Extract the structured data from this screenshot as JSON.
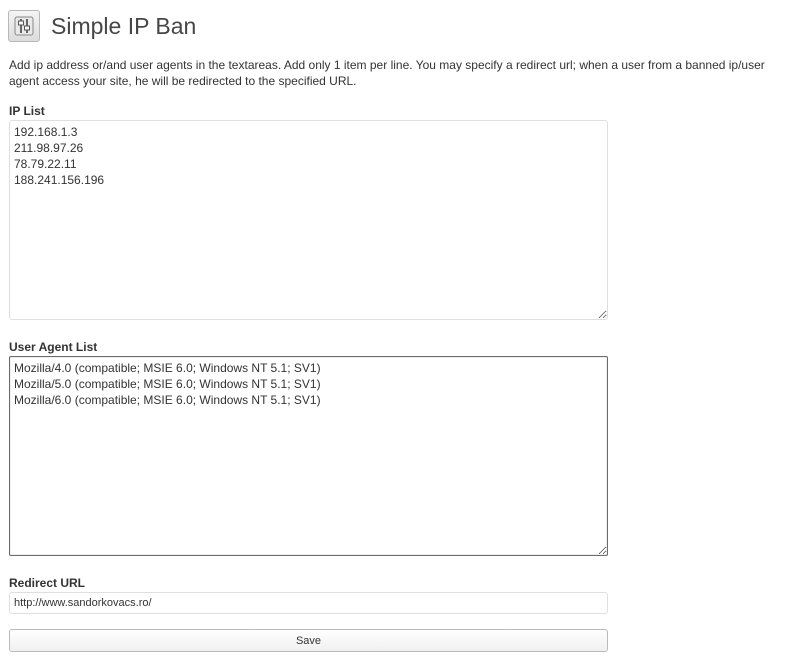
{
  "header": {
    "title": "Simple IP Ban",
    "icon": "plugin-settings-icon"
  },
  "description": "Add ip address or/and user agents in the textareas. Add only 1 item per line. You may specify a redirect url; when a user from a banned ip/user agent access your site, he will be redirected to the specified URL.",
  "ip_list": {
    "label": "IP List",
    "value": "192.168.1.3\n211.98.97.26\n78.79.22.11\n188.241.156.196"
  },
  "user_agent_list": {
    "label": "User Agent List",
    "value": "Mozilla/4.0 (compatible; MSIE 6.0; Windows NT 5.1; SV1)\nMozilla/5.0 (compatible; MSIE 6.0; Windows NT 5.1; SV1)\nMozilla/6.0 (compatible; MSIE 6.0; Windows NT 5.1; SV1)"
  },
  "redirect_url": {
    "label": "Redirect URL",
    "value": "http://www.sandorkovacs.ro/"
  },
  "save_button": {
    "label": "Save"
  }
}
